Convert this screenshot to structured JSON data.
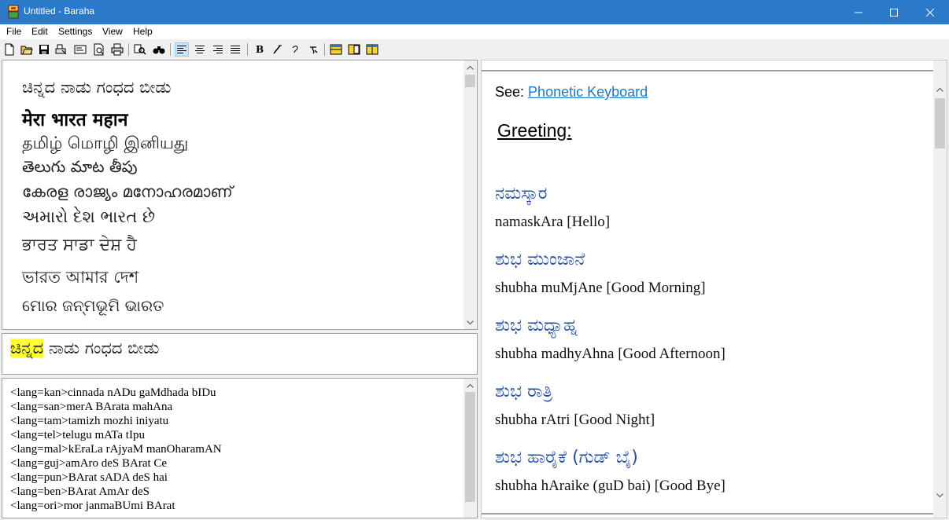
{
  "window": {
    "title": "Untitled - Baraha"
  },
  "menu": [
    "File",
    "Edit",
    "Settings",
    "View",
    "Help"
  ],
  "toolbar": {
    "icons": [
      "new-icon",
      "open-icon",
      "save-icon",
      "print-setup-icon",
      "properties-icon",
      "print-preview-icon",
      "print-icon",
      "find-icon",
      "find-replace-icon",
      "align-left-icon",
      "align-center-icon",
      "align-right-icon",
      "justify-icon",
      "bold-icon",
      "italic-icon",
      "font-char-icon",
      "script-char-icon",
      "layout-single-icon",
      "layout-split-icon",
      "layout-side-icon"
    ]
  },
  "top_pane": {
    "lines": [
      "ಚಿನ್ನದ ನಾಡು ಗಂಧದ ಬೀಡು",
      "मेरा भारत महान",
      "தமிழ் மொழி இனியது",
      "తెలుగు మాట తీపు",
      "കേരള രാജ്യം മനോഹരമാണ്",
      "અમારો દેશ ભારત છે",
      "ਭਾਰਤ ਸਾਡਾ ਦੇਸ਼ ਹੈ",
      "ভারত আমার দেশ",
      "ମୋର ଜନ୍ମଭୂମି ଭାରତ"
    ]
  },
  "edit_pane": {
    "highlighted": "ಚಿನ್ನದ",
    "rest": " ನಾಡು ಗಂಧದ ಬೀಡು"
  },
  "code_pane": {
    "lines": [
      "<lang=kan>cinnada nADu gaMdhada bIDu",
      "<lang=san>merA BArata mahAna",
      "<lang=tam>tamizh mozhi iniyatu",
      "<lang=tel>telugu mATa tIpu",
      "<lang=mal>kEraLa rAjyaM manOharamAN",
      "<lang=guj>amAro deS BArat Ce",
      "<lang=pun>BArat sADA deS hai",
      "<lang=ben>BArat AmAr deS",
      "<lang=ori>mor janmaBUmi BArat"
    ]
  },
  "help_pane": {
    "see_label": "See:",
    "link": "Phonetic Keyboard",
    "heading": "Greeting:",
    "entries": [
      {
        "kannada": "ನಮಸ್ಕಾರ",
        "translit": "namaskAra [Hello]"
      },
      {
        "kannada": "ಶುಭ ಮುಂಜಾನೆ",
        "translit": "shubha muMjAne [Good Morning]"
      },
      {
        "kannada": "ಶುಭ ಮಧ್ಯಾಹ್ನ",
        "translit": "shubha madhyAhna [Good Afternoon]"
      },
      {
        "kannada": "ಶುಭ ರಾತ್ರಿ",
        "translit": "shubha rAtri [Good Night]"
      },
      {
        "kannada": "ಶುಭ ಹಾರೈಕೆ (ಗುಡ್ ಬೈ)",
        "translit": "shubha hAraike (guD bai) [Good Bye]"
      }
    ]
  },
  "colors": {
    "titlebar": "#2b79c9",
    "highlight": "#ffff33",
    "kannada_text": "#1f4fa8",
    "link": "#1a7ac9"
  }
}
